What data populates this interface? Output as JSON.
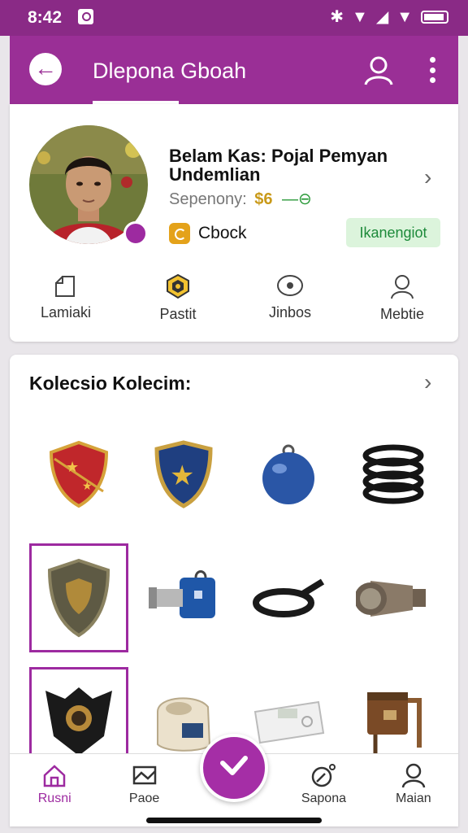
{
  "status_bar": {
    "time": "8:42"
  },
  "app_bar": {
    "title": "Dlepona Gboah"
  },
  "profile": {
    "name": "Belam Kas: Pojal Pemyan Undemlian",
    "subtitle_label": "Sepenony:",
    "price": "$6",
    "price_icon": "—⊖",
    "coin_label": "Cbock",
    "status_badge": "Ikanengiot"
  },
  "quick_actions": [
    {
      "label": "Lamiaki",
      "icon": "document-icon"
    },
    {
      "label": "Pastit",
      "icon": "shield-badge-icon"
    },
    {
      "label": "Jinbos",
      "icon": "eye-icon"
    },
    {
      "label": "Mebtie",
      "icon": "person-icon"
    }
  ],
  "collection": {
    "title": "Kolecsio Kolecim:",
    "items": [
      {
        "name": "red-shield",
        "selected": false
      },
      {
        "name": "blue-star-shield",
        "selected": false
      },
      {
        "name": "blue-orb",
        "selected": false
      },
      {
        "name": "black-coil",
        "selected": false
      },
      {
        "name": "bronze-shield",
        "selected": true
      },
      {
        "name": "blue-camera",
        "selected": false
      },
      {
        "name": "black-strap",
        "selected": false
      },
      {
        "name": "metal-lamp",
        "selected": false
      },
      {
        "name": "black-shield",
        "selected": true
      },
      {
        "name": "cream-device",
        "selected": false
      },
      {
        "name": "white-device",
        "selected": false
      },
      {
        "name": "brown-machine",
        "selected": false
      }
    ]
  },
  "bottom_nav": [
    {
      "label": "Rusni",
      "active": true
    },
    {
      "label": "Paoe",
      "active": false
    },
    {
      "label": "Sapona",
      "active": false
    },
    {
      "label": "Maian",
      "active": false
    }
  ],
  "colors": {
    "primary": "#9a2f96",
    "accent": "#a52ea6",
    "badge_bg": "#dcf4dc",
    "badge_text": "#1d8a3a"
  }
}
